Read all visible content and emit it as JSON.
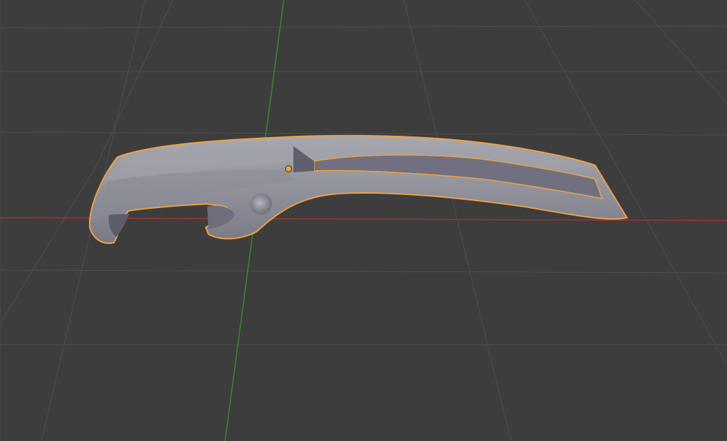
{
  "viewport": {
    "background": "#3d3d3d",
    "grid_color": "#4f4f4f",
    "x_axis_color": "#a33434",
    "y_axis_color": "#2f8f2f",
    "selection_outline_color": "#f0a040",
    "origin_dot_color": "#f0a040",
    "mesh_base_color": "#8e8e98",
    "mesh_top_color": "#a6a6ae",
    "mesh_shadow_color": "#6e6e7a"
  },
  "selected_object": {
    "icon": "bottle-opener-mesh",
    "selected": true
  }
}
